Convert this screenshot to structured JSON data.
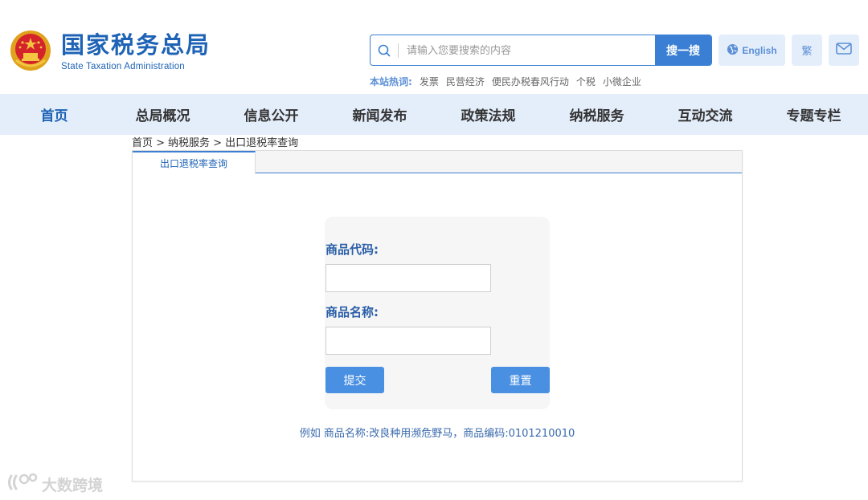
{
  "header": {
    "logo_cn": "国家税务总局",
    "logo_en": "State Taxation Administration",
    "search": {
      "placeholder": "请输入您要搜索的内容",
      "button_label": "搜一搜"
    },
    "hotwords": {
      "label": "本站热词:",
      "items": [
        "发票",
        "民营经济",
        "便民办税春风行动",
        "个税",
        "小微企业"
      ]
    },
    "english_label": "English",
    "traditional_label": "繁"
  },
  "nav": {
    "items": [
      "首页",
      "总局概况",
      "信息公开",
      "新闻发布",
      "政策法规",
      "纳税服务",
      "互动交流",
      "专题专栏"
    ],
    "active_index": 0
  },
  "breadcrumb": {
    "items": [
      "首页 >",
      "纳税服务 >",
      "出口退税率查询"
    ]
  },
  "panel": {
    "tab_label": "出口退税率查询",
    "form": {
      "code_label": "商品代码:",
      "code_value": "",
      "name_label": "商品名称:",
      "name_value": "",
      "submit_label": "提交",
      "reset_label": "重置"
    },
    "example_text": "例如 商品名称:改良种用濒危野马，商品编码:0101210010"
  },
  "watermark": {
    "text": "大数跨境"
  },
  "colors": {
    "brand": "#1e63b5",
    "accent": "#3a7fd4",
    "nav_bg": "#e4eefb",
    "button": "#4a90e2"
  }
}
